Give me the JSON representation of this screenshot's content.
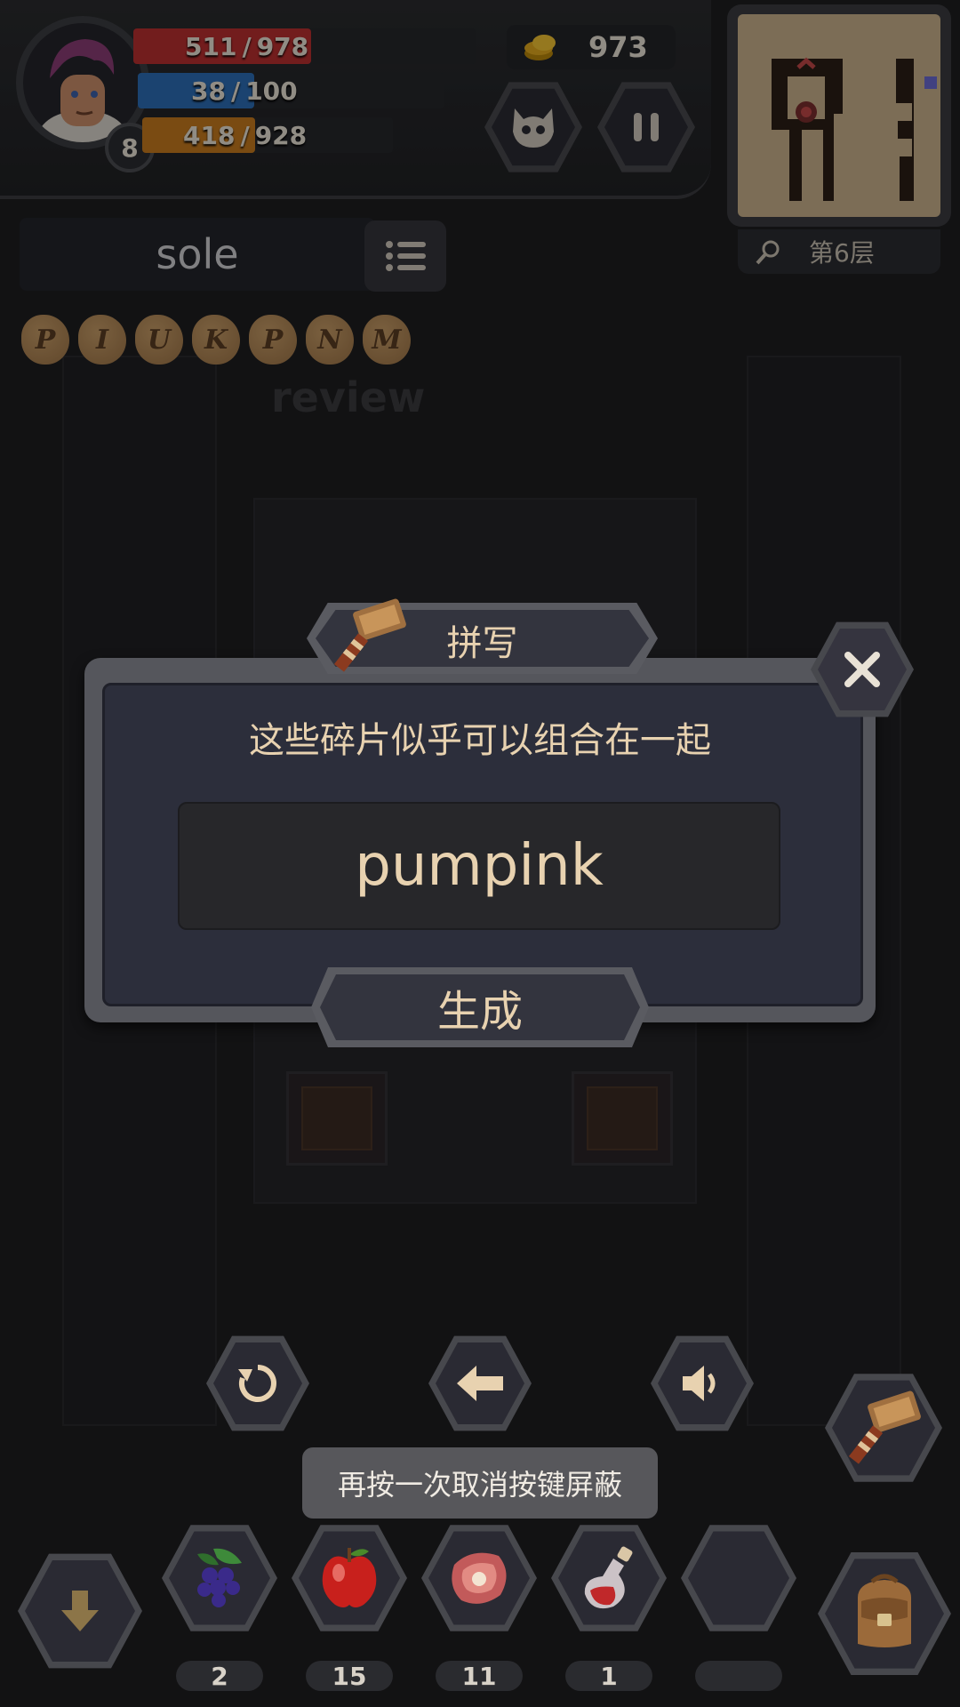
{
  "hud": {
    "level": "8",
    "hp": {
      "current": "511",
      "max": "978",
      "fraction": 0.52,
      "color": "#b92f2f"
    },
    "mp": {
      "current": "38",
      "max": "100",
      "fraction": 0.38,
      "color": "#2c6db5"
    },
    "xp": {
      "current": "418",
      "max": "928",
      "fraction": 0.45,
      "color": "#c67a1e"
    },
    "separator": "/",
    "gold": "973",
    "floor_label": "第6层"
  },
  "word_panel": {
    "word": "sole",
    "runes": [
      "P",
      "I",
      "U",
      "K",
      "P",
      "N",
      "M"
    ],
    "background_hint": "review"
  },
  "dialog": {
    "title": "拼写",
    "message": "这些碎片似乎可以组合在一起",
    "input_value": "pumpink",
    "generate_label": "生成"
  },
  "toast": "再按一次取消按键屏蔽",
  "inventory": [
    {
      "name": "grapes",
      "count": "2"
    },
    {
      "name": "apple",
      "count": "15"
    },
    {
      "name": "meat",
      "count": "11"
    },
    {
      "name": "potion",
      "count": "1"
    },
    {
      "name": "empty",
      "count": ""
    }
  ],
  "colors": {
    "accent_text": "#e8d2b0",
    "panel": "#2c2e3b",
    "frame": "#55565c"
  }
}
